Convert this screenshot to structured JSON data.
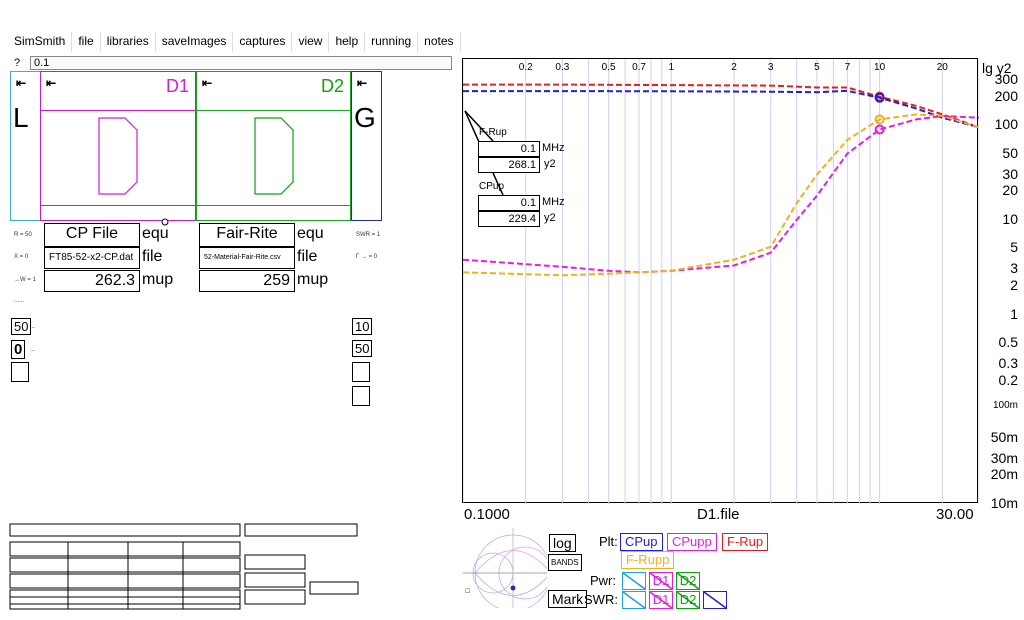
{
  "menu": [
    "SimSmith",
    "file",
    "libraries",
    "saveImages",
    "captures",
    "view",
    "help",
    "running",
    "notes"
  ],
  "cmd": {
    "prompt": "?",
    "value": "0.1"
  },
  "schematic": {
    "left_letter": "L",
    "right_letter": "G",
    "d1_label": "D1",
    "d2_label": "D2",
    "d1_color": "#d020d0",
    "d2_color": "#10a010"
  },
  "d1_fields": {
    "name": "CP File",
    "name_suffix": "equ",
    "file": "FT85-52-x2-CP.dat",
    "file_suffix": "file",
    "value": "262.3",
    "value_suffix": "mup"
  },
  "d2_fields": {
    "name": "Fair-Rite",
    "name_suffix": "equ",
    "file": "52-Material-Fair-Rite.csv",
    "file_suffix": "file",
    "value": "259",
    "value_suffix": "mup"
  },
  "left_boxes": [
    "50",
    "0"
  ],
  "right_boxes": [
    "10",
    "50"
  ],
  "chart": {
    "x_top_ticks": [
      "0.2",
      "0.3",
      "0.5",
      "0.7",
      "1",
      "2",
      "3",
      "5",
      "7",
      "10",
      "20"
    ],
    "y_title": "lg y2",
    "y_ticks": [
      "300",
      "200",
      "100",
      "50",
      "30",
      "20",
      "10",
      "5",
      "3",
      "2",
      "1",
      "0.5",
      "0.3",
      "0.2",
      "100m",
      "50m",
      "30m",
      "20m",
      "10m"
    ],
    "x_min_label": "0.1000",
    "x_mid_label": "D1.file",
    "x_max_label": "30.00",
    "fup": {
      "label": "F-Rup",
      "freq": "0.1",
      "unit": "MHz",
      "val": "268.1",
      "vlabel": "y2"
    },
    "cpup": {
      "label": "CPup",
      "freq": "0.1",
      "unit": "MHz",
      "val": "229.4",
      "vlabel": "y2"
    }
  },
  "chart_data": {
    "type": "line",
    "xlabel": "D1.file",
    "ylabel": "lg y2",
    "xlim": [
      0.1,
      30
    ],
    "ylim": [
      0.01,
      500
    ],
    "series": [
      {
        "name": "F-Rup",
        "color": "#e02020",
        "x": [
          0.1,
          0.3,
          1,
          3,
          5,
          7,
          10,
          15,
          20,
          30
        ],
        "y": [
          268,
          268,
          265,
          262,
          250,
          250,
          200,
          160,
          130,
          95
        ]
      },
      {
        "name": "CPup",
        "color": "#2020d0",
        "x": [
          0.1,
          0.3,
          1,
          3,
          5,
          7,
          10,
          15,
          20,
          30
        ],
        "y": [
          229,
          229,
          228,
          226,
          223,
          230,
          195,
          150,
          120,
          95
        ]
      },
      {
        "name": "CPupp",
        "color": "#e020e0",
        "x": [
          0.1,
          0.3,
          0.5,
          0.7,
          1,
          2,
          3,
          4,
          5,
          7,
          10,
          15,
          20,
          30
        ],
        "y": [
          3.8,
          3.2,
          2.9,
          2.8,
          2.9,
          3.3,
          4.5,
          10,
          18,
          50,
          90,
          115,
          125,
          120
        ]
      },
      {
        "name": "F-Rupp",
        "color": "#f0b020",
        "x": [
          0.1,
          0.3,
          0.5,
          0.7,
          1,
          2,
          3,
          4,
          5,
          7,
          10,
          15,
          20,
          30
        ],
        "y": [
          2.8,
          2.6,
          2.7,
          2.8,
          2.9,
          3.8,
          5.2,
          15,
          30,
          70,
          115,
          130,
          125,
          95
        ]
      }
    ],
    "markers_x": 10
  },
  "bottom": {
    "log_btn": "log",
    "bands_btn": "BANDS",
    "mark_btn": "Mark",
    "plt_label": "Plt:",
    "pwr_label": "Pwr:",
    "swr_label": "SWR:",
    "plt_tags": [
      {
        "text": "CPup",
        "color": "#2020d0"
      },
      {
        "text": "CPupp",
        "color": "#e020e0"
      },
      {
        "text": "F-Rup",
        "color": "#e02020"
      },
      {
        "text": "F-Rupp",
        "color": "#f0b020"
      }
    ],
    "pwr_tags": [
      {
        "text": "",
        "color": "#20a0e0"
      },
      {
        "text": "D1",
        "color": "#e020e0"
      },
      {
        "text": "D2",
        "color": "#10a010"
      }
    ],
    "swr_tags": [
      {
        "text": "",
        "color": "#20a0e0"
      },
      {
        "text": "D1",
        "color": "#e020e0"
      },
      {
        "text": "D2",
        "color": "#10a010"
      },
      {
        "text": "",
        "color": "#2020d0"
      }
    ]
  }
}
